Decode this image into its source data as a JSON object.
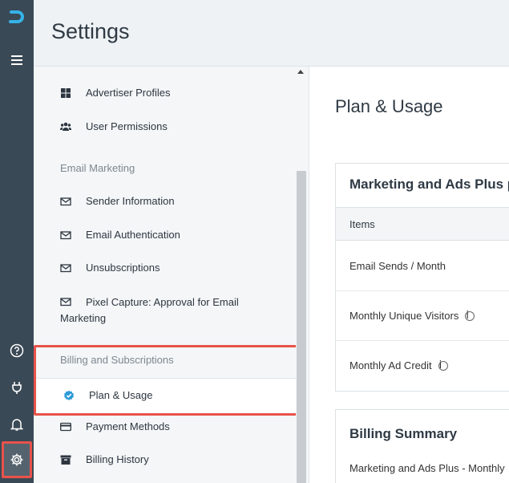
{
  "header": {
    "title": "Settings"
  },
  "nav": {
    "items_top": [
      {
        "label": "Advertiser Profiles",
        "icon": "grid-icon"
      },
      {
        "label": "User Permissions",
        "icon": "users-icon"
      }
    ],
    "email_section": "Email Marketing",
    "email_items": [
      {
        "label": "Sender Information",
        "icon": "envelope-icon"
      },
      {
        "label": "Email Authentication",
        "icon": "envelope-icon"
      },
      {
        "label": "Unsubscriptions",
        "icon": "envelope-icon"
      },
      {
        "label_line1": "Pixel Capture: Approval for Email",
        "label_line2": "Marketing",
        "icon": "envelope-icon"
      }
    ],
    "billing_section": "Billing and Subscriptions",
    "billing_items": [
      {
        "label": "Plan & Usage",
        "icon": "check-badge-icon",
        "selected": true
      },
      {
        "label": "Payment Methods",
        "icon": "credit-card-icon"
      },
      {
        "label": "Billing History",
        "icon": "archive-icon"
      }
    ]
  },
  "main": {
    "title": "Plan & Usage",
    "plan_card": {
      "title": "Marketing and Ads Plus pl",
      "column_header": "Items",
      "rows": [
        {
          "label": "Email Sends / Month",
          "info": false
        },
        {
          "label": "Monthly Unique Visitors",
          "info": true
        },
        {
          "label": "Monthly Ad Credit",
          "info": true
        }
      ]
    },
    "billing_card": {
      "title": "Billing Summary",
      "line": "Marketing and Ads Plus - Monthly"
    }
  },
  "colors": {
    "rail": "#3a4956",
    "highlight": "#e8534a",
    "accent": "#2e9bd6"
  }
}
